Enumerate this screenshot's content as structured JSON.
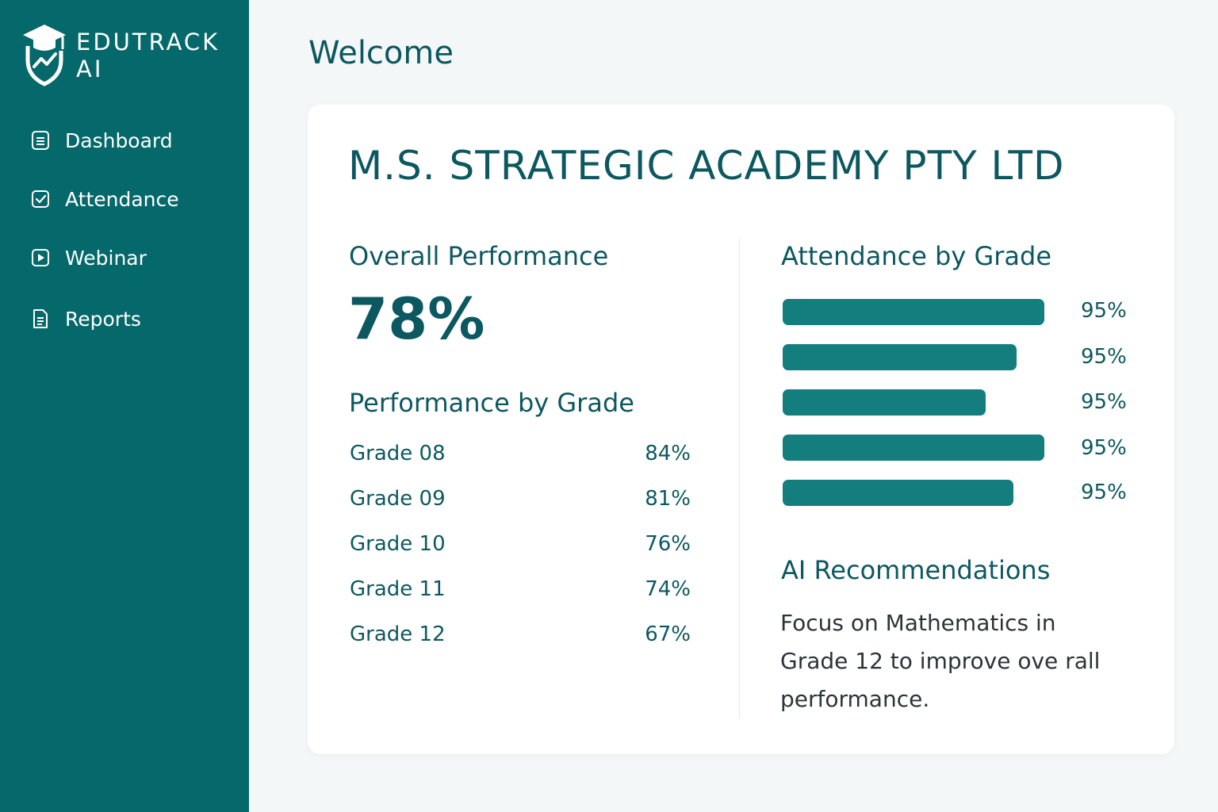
{
  "brand": {
    "line1": "EDUTRACK",
    "line2": "AI",
    "logo_icon": "graduation-shield-icon"
  },
  "sidebar": {
    "items": [
      {
        "label": "Dashboard",
        "icon": "document-icon"
      },
      {
        "label": "Attendance",
        "icon": "checkbox-icon"
      },
      {
        "label": "Webinar",
        "icon": "play-icon"
      },
      {
        "label": "Reports",
        "icon": "report-icon"
      }
    ]
  },
  "header": {
    "title": "Welcome"
  },
  "card": {
    "org_name": "M.S. STRATEGIC ACADEMY PTY LTD",
    "overall": {
      "title": "Overall Performance",
      "value": "78%"
    },
    "performance_by_grade": {
      "title": "Performance by Grade",
      "rows": [
        {
          "grade": "Grade 08",
          "value": "84%"
        },
        {
          "grade": "Grade 09",
          "value": "81%"
        },
        {
          "grade": "Grade 10",
          "value": "76%"
        },
        {
          "grade": "Grade 11",
          "value": "74%"
        },
        {
          "grade": "Grade 12",
          "value": "67%"
        }
      ]
    },
    "attendance_by_grade": {
      "title": "Attendance by Grade",
      "bars": [
        {
          "label": "95%",
          "fill": 1.0
        },
        {
          "label": "95%",
          "fill": 0.893
        },
        {
          "label": "95%",
          "fill": 0.775
        },
        {
          "label": "95%",
          "fill": 1.0
        },
        {
          "label": "95%",
          "fill": 0.881
        }
      ]
    },
    "ai_recommendations": {
      "title": "AI Recommendations",
      "text": "Focus on Mathematics in Grade 12 to improve ove rall performance."
    }
  },
  "colors": {
    "sidebar": "#05686a",
    "accent": "#147d7d",
    "heading": "#0c5860",
    "background": "#f4f7f8"
  }
}
